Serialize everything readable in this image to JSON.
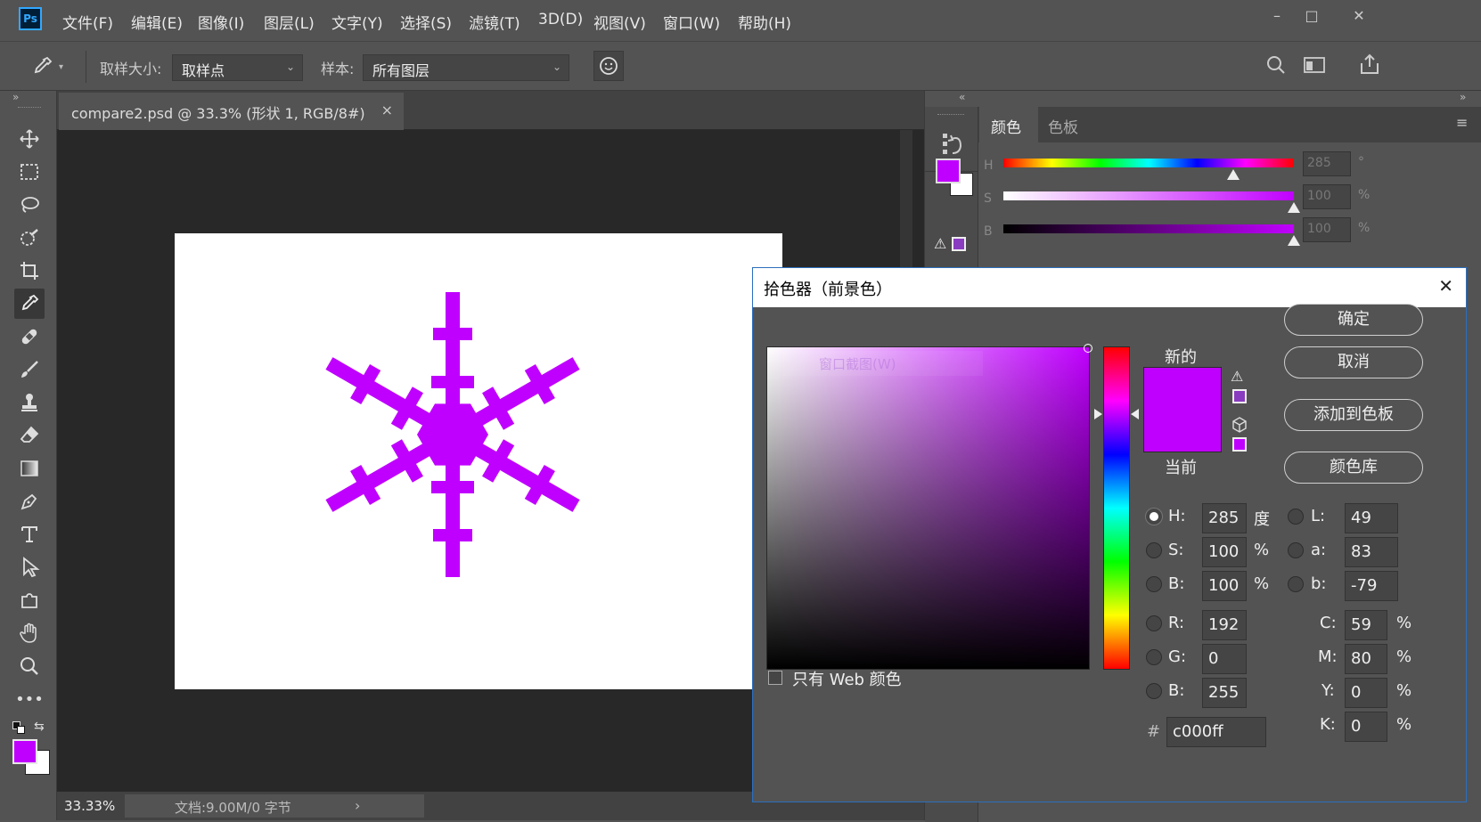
{
  "app": {
    "logo": "Ps"
  },
  "menu": [
    "文件(F)",
    "编辑(E)",
    "图像(I)",
    "图层(L)",
    "文字(Y)",
    "选择(S)",
    "滤镜(T)",
    "3D(D)",
    "视图(V)",
    "窗口(W)",
    "帮助(H)"
  ],
  "window_controls": {
    "minimize": "–",
    "maximize": "□",
    "close": "✕"
  },
  "options": {
    "sample_size_label": "取样大小:",
    "sample_size_value": "取样点",
    "sample_label": "样本:",
    "sample_value": "所有图层"
  },
  "document": {
    "tab_title": "compare2.psd @ 33.3% (形状 1, RGB/8#)",
    "tab_close": "×",
    "zoom": "33.33%",
    "doc_info": "文档:9.00M/0 字节",
    "status_arrow": "›"
  },
  "color_panel": {
    "tabs": [
      "颜色",
      "色板"
    ],
    "sliders": [
      {
        "label": "H",
        "value": "285",
        "unit": "°",
        "position": 0.79
      },
      {
        "label": "S",
        "value": "100",
        "unit": "%",
        "position": 1.0
      },
      {
        "label": "B",
        "value": "100",
        "unit": "%",
        "position": 1.0
      }
    ],
    "foreground": "#c000ff",
    "background": "#ffffff"
  },
  "picker": {
    "title": "拾色器（前景色）",
    "close": "✕",
    "ghost_text": "窗口截图(W)",
    "new_label": "新的",
    "current_label": "当前",
    "new_color": "#c000ff",
    "current_color": "#c000ff",
    "hue_color": "#c000ff",
    "hue_position": 0.209,
    "web_only_label": "只有 Web 颜色",
    "buttons": {
      "ok": "确定",
      "cancel": "取消",
      "add": "添加到色板",
      "library": "颜色库"
    },
    "hsb": [
      {
        "label": "H:",
        "value": "285",
        "unit": "度",
        "selected": true
      },
      {
        "label": "S:",
        "value": "100",
        "unit": "%",
        "selected": false
      },
      {
        "label": "B:",
        "value": "100",
        "unit": "%",
        "selected": false
      }
    ],
    "rgb": [
      {
        "label": "R:",
        "value": "192"
      },
      {
        "label": "G:",
        "value": "0"
      },
      {
        "label": "B:",
        "value": "255"
      }
    ],
    "lab": [
      {
        "label": "L:",
        "value": "49"
      },
      {
        "label": "a:",
        "value": "83"
      },
      {
        "label": "b:",
        "value": "-79"
      }
    ],
    "cmyk": [
      {
        "label": "C:",
        "value": "59",
        "unit": "%"
      },
      {
        "label": "M:",
        "value": "80",
        "unit": "%"
      },
      {
        "label": "Y:",
        "value": "0",
        "unit": "%"
      },
      {
        "label": "K:",
        "value": "0",
        "unit": "%"
      }
    ],
    "hex_label": "#",
    "hex": "c000ff"
  },
  "colors": {
    "accent": "#c000ff",
    "ui_bg": "#535353",
    "canvas_bg": "#282828"
  }
}
